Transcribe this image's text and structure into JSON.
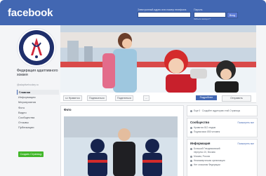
{
  "header": {
    "logo": "facebook",
    "login_label": "Электронный адрес или номер телефона",
    "password_label": "Пароль",
    "login_button": "Вход",
    "forgot_link": "Забыли аккаунт?"
  },
  "page": {
    "name": "Федерация адаптивного хоккея",
    "handle": "@adaptivehockey.ru"
  },
  "nav": {
    "items": [
      "Главная",
      "Информация",
      "Мероприятия",
      "Фото",
      "Видео",
      "Сообщества",
      "Отзывы",
      "Публикации"
    ],
    "create_button": "Создать Страницу"
  },
  "actions": {
    "like": "Нравится",
    "follow": "Подписаться",
    "share": "Поделиться",
    "more": "...",
    "primary": "Подробнее",
    "send": "Отправить"
  },
  "posts": {
    "title": "Фото"
  },
  "sidebar": {
    "stats": "Еще 0 · Создайте аудиторию этой Страницы",
    "community": {
      "title": "Сообщество",
      "link": "Посмотреть все",
      "rows": [
        "Нравится 812 людям",
        "Подписчики: 850 человек"
      ]
    },
    "info": {
      "title": "Информация",
      "link": "Посмотреть все",
      "rows": [
        "Большой Гнездниковский",
        "переулок 10, Москва",
        "Москва, Россия",
        "Некоммерческая организация",
        "Нет описания Федерации"
      ]
    }
  },
  "colors": {
    "brand": "#4267b2",
    "create": "#42b72a"
  }
}
